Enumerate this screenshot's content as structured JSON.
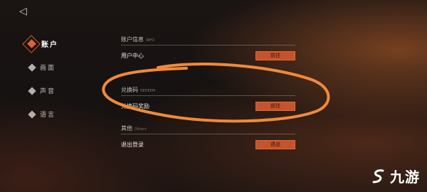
{
  "back_icon": "back-arrow-icon",
  "sidebar": {
    "items": [
      {
        "label": "账户",
        "active": true
      },
      {
        "label": "画面",
        "active": false
      },
      {
        "label": "声音",
        "active": false
      },
      {
        "label": "语言",
        "active": false
      }
    ]
  },
  "sections": [
    {
      "title": "账户信息",
      "subtitle": "INFO",
      "rows": [
        {
          "label": "用户中心",
          "button": "前往"
        }
      ]
    },
    {
      "title": "兑换码",
      "subtitle": "REDEEM",
      "rows": [
        {
          "label": "兑换码奖励",
          "button": "前往"
        }
      ]
    },
    {
      "title": "其他",
      "subtitle": "Others",
      "rows": [
        {
          "label": "退出登录",
          "button": "退出"
        }
      ]
    }
  ],
  "watermark": {
    "text": "九游"
  },
  "colors": {
    "accent": "#c5532c",
    "scribble": "#f08a3a"
  }
}
